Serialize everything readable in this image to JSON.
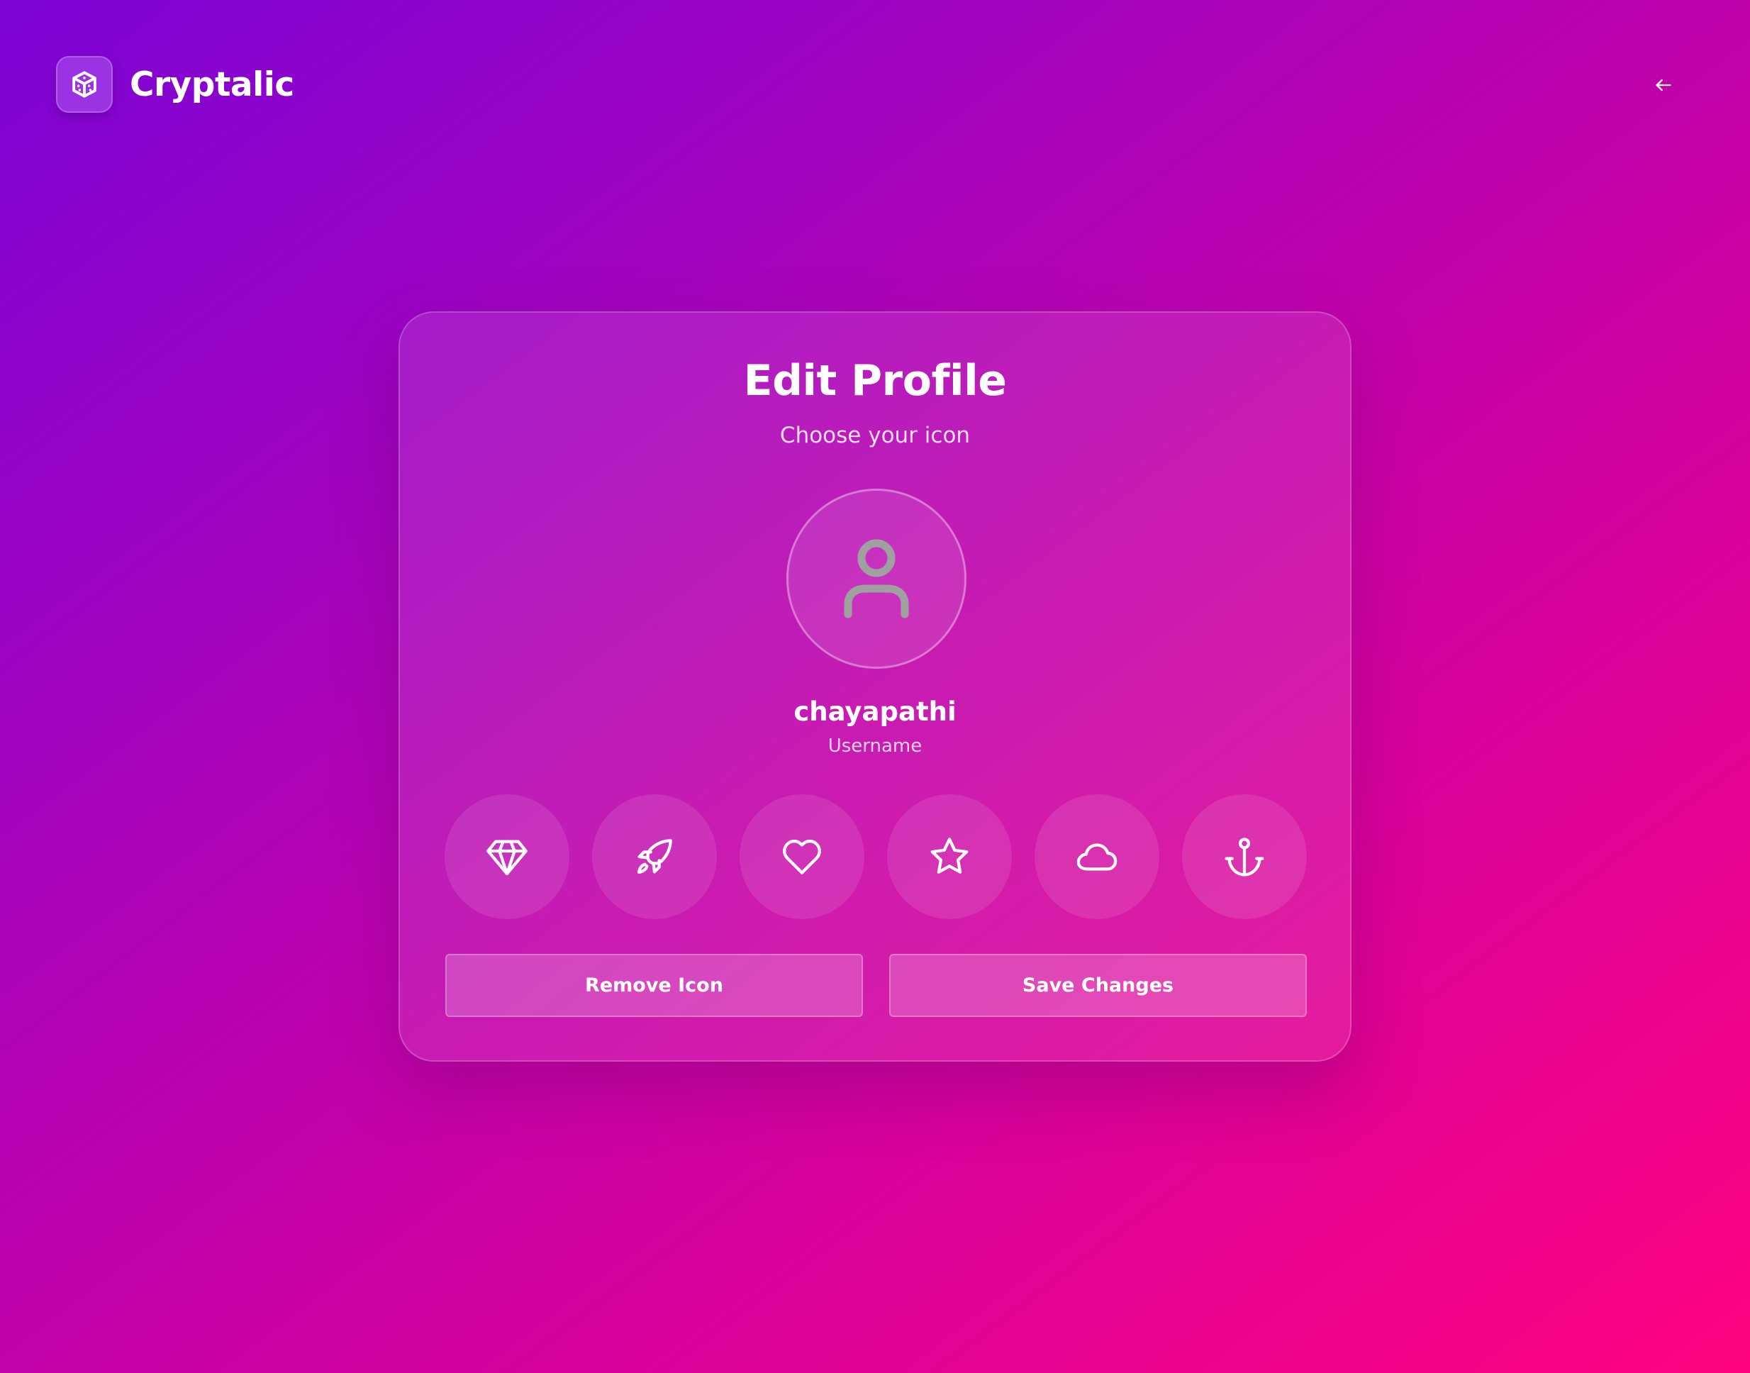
{
  "header": {
    "brand_name": "Cryptalic",
    "logo_icon": "cube-icon",
    "back_icon": "arrow-left-icon"
  },
  "card": {
    "title": "Edit Profile",
    "subtitle": "Choose your icon",
    "avatar_icon": "user-icon",
    "username": "chayapathi",
    "username_label": "Username",
    "icon_options": [
      "diamond-icon",
      "rocket-icon",
      "heart-icon",
      "star-icon",
      "cloud-icon",
      "anchor-icon"
    ],
    "remove_label": "Remove Icon",
    "save_label": "Save Changes"
  },
  "colors": {
    "gradient_start": "#7d04d6",
    "gradient_end": "#fe037f",
    "text": "#ffffff",
    "avatar_icon": "#a0a0a0"
  }
}
